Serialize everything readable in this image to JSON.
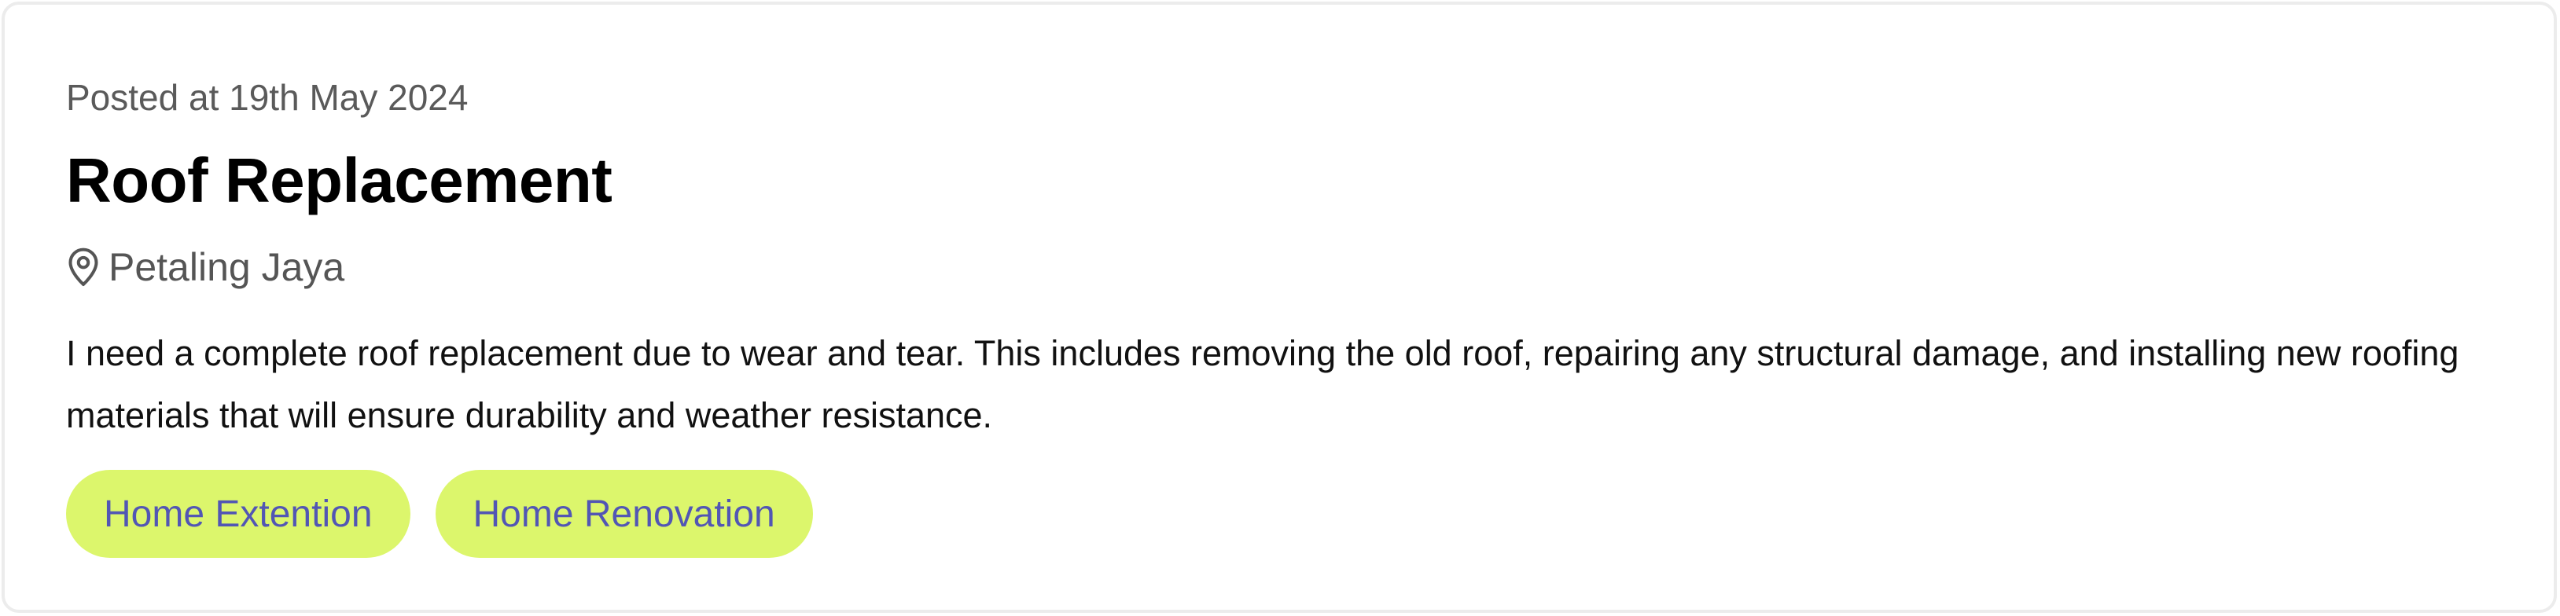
{
  "job_card": {
    "posted": "Posted at 19th May 2024",
    "title": "Roof Replacement",
    "location": {
      "icon": "map-pin-icon",
      "text": "Petaling Jaya"
    },
    "description": "I need a complete roof replacement due to wear and tear. This includes removing the old roof, repairing any structural damage, and installing new roofing materials that will ensure durability and weather resistance.",
    "tags": [
      {
        "label": "Home Extention"
      },
      {
        "label": "Home Renovation"
      }
    ]
  },
  "colors": {
    "tag_background": "#dcf66c",
    "tag_text": "#5256b4",
    "muted_text": "#5a5a5a",
    "card_border": "#ececec"
  }
}
